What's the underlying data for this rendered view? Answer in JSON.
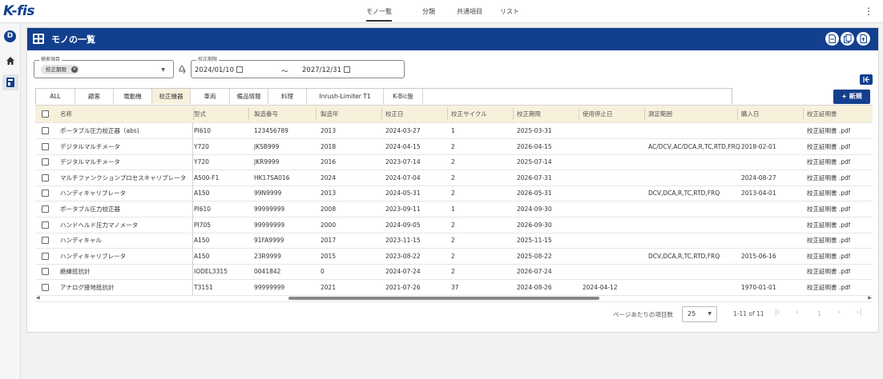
{
  "app": {
    "logo": "K-fis"
  },
  "topnav": {
    "items": [
      "モノ一覧",
      "分類",
      "共通項目",
      "リスト"
    ],
    "active": "モノ一覧"
  },
  "rail": {
    "badge": "D"
  },
  "page": {
    "title": "モノの一覧"
  },
  "filters": {
    "search_legend": "検索項目",
    "chip": "校正期限",
    "date_legend": "校正期限",
    "date_from": "2024/01/10",
    "date_sep": "〜",
    "date_to": "2027/12/31"
  },
  "tabs": [
    "ALL",
    "顧客",
    "電動機",
    "校正機器",
    "車両",
    "備品情報",
    "料理",
    "Inrush-Limiter T1",
    "K-Bic盤"
  ],
  "active_tab": "校正機器",
  "new_button": "+ 新規",
  "table": {
    "columns": [
      "名称",
      "型式",
      "製造番号",
      "製造年",
      "校正日",
      "校正サイクル",
      "校正期限",
      "使用停止日",
      "測定範囲",
      "購入日",
      "校正証明書"
    ],
    "rows": [
      [
        "ポータブル圧力校正器（abs)",
        "PI610",
        "123456789",
        "2013",
        "2024-03-27",
        "1",
        "2025-03-31",
        "",
        "",
        "",
        "校正証明書 .pdf"
      ],
      [
        "デジタルマルチメータ",
        "Y720",
        "JKSB999",
        "2018",
        "2024-04-15",
        "2",
        "2026-04-15",
        "",
        "AC/DCV,AC/DCA,R,TC,RTD,FRQ",
        "2018-02-01",
        "校正証明書 .pdf"
      ],
      [
        "デジタルマルチメータ",
        "Y720",
        "JKR9999",
        "2016",
        "2023-07-14",
        "2",
        "2025-07-14",
        "",
        "",
        "",
        "校正証明書 .pdf"
      ],
      [
        "マルチファンクションプロセスキャリブレータ",
        "A500-F1",
        "HK17SA016",
        "2024",
        "2024-07-04",
        "2",
        "2026-07-31",
        "",
        "",
        "2024-08-27",
        "校正証明書 .pdf"
      ],
      [
        "ハンディキャリブレータ",
        "A150",
        "99N9999",
        "2013",
        "2024-05-31",
        "2",
        "2026-05-31",
        "",
        "DCV,DCA,R,TC,RTD,FRQ",
        "2013-04-01",
        "校正証明書 .pdf"
      ],
      [
        "ポータブル圧力校正器",
        "PI610",
        "99999999",
        "2008",
        "2023-09-11",
        "1",
        "2024-09-30",
        "",
        "",
        "",
        "校正証明書 .pdf"
      ],
      [
        "ハンドヘルド圧力マノメータ",
        "PI705",
        "99999999",
        "2000",
        "2024-09-05",
        "2",
        "2026-09-30",
        "",
        "",
        "",
        "校正証明書 .pdf"
      ],
      [
        "ハンディキャル",
        "A150",
        "91FA9999",
        "2017",
        "2023-11-15",
        "2",
        "2025-11-15",
        "",
        "",
        "",
        "校正証明書 .pdf"
      ],
      [
        "ハンディキャリブレータ",
        "A150",
        "23R9999",
        "2015",
        "2023-08-22",
        "2",
        "2025-08-22",
        "",
        "DCV,DCA,R,TC,RTD,FRQ",
        "2015-06-16",
        "校正証明書 .pdf"
      ],
      [
        "絶縁抵抗計",
        "IODEL3315",
        "0041842",
        "0",
        "2024-07-24",
        "2",
        "2026-07-24",
        "",
        "",
        "",
        "校正証明書 .pdf"
      ],
      [
        "アナログ接地抵抗計",
        "T3151",
        "99999999",
        "2021",
        "2021-07-26",
        "37",
        "2024-08-26",
        "2024-04-12",
        "",
        "1970-01-01",
        "校正証明書 .pdf"
      ]
    ]
  },
  "pager": {
    "label": "ページあたりの項目数",
    "page_size": "25",
    "range": "1-11 of 11",
    "current_page": "1"
  },
  "colors": {
    "primary": "#123f8e",
    "header_bg": "#f7f1dc"
  }
}
